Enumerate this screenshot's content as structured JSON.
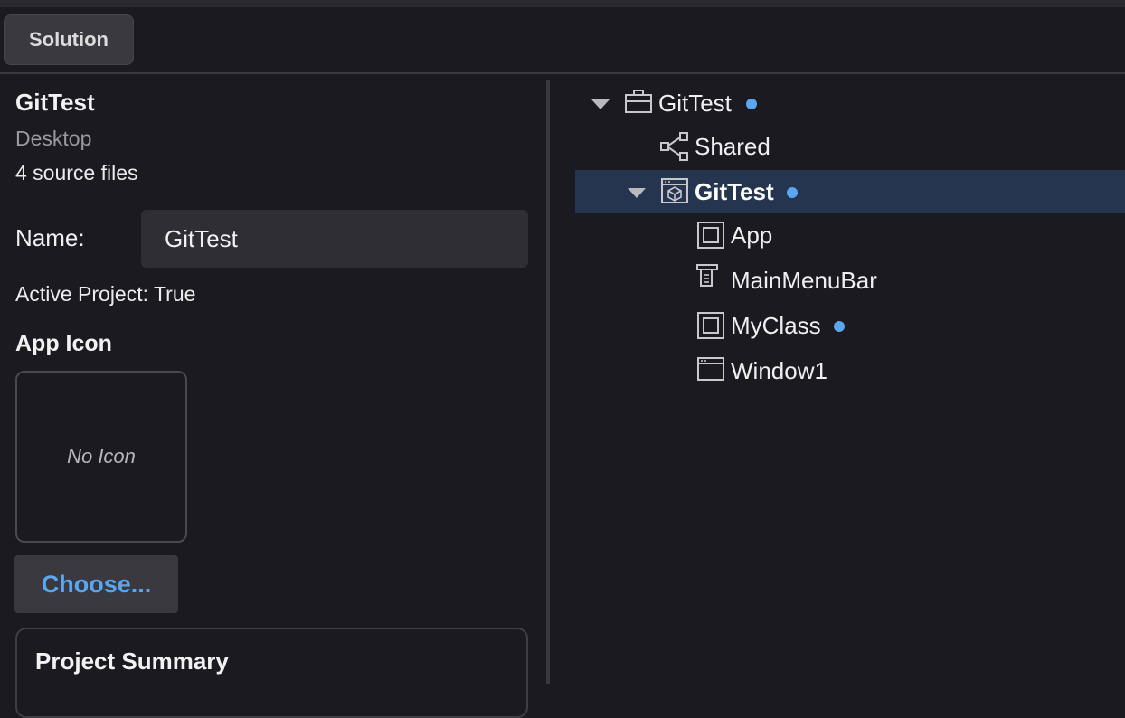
{
  "toolbar": {
    "solution_tab": "Solution"
  },
  "project": {
    "title": "GitTest",
    "platform": "Desktop",
    "source_files": "4 source files",
    "name_label": "Name:",
    "name_value": "GitTest",
    "active_project": "Active Project: True",
    "app_icon_label": "App Icon",
    "no_icon": "No Icon",
    "choose_label": "Choose...",
    "summary_title": "Project Summary"
  },
  "tree": {
    "root": {
      "label": "GitTest",
      "icon": "briefcase-icon",
      "modified": true
    },
    "shared": {
      "label": "Shared",
      "icon": "share-icon"
    },
    "project": {
      "label": "GitTest",
      "icon": "app-bundle-icon",
      "modified": true,
      "selected": true
    },
    "items": [
      {
        "label": "App",
        "icon": "class-icon",
        "modified": false
      },
      {
        "label": "MainMenuBar",
        "icon": "menubar-icon",
        "modified": false
      },
      {
        "label": "MyClass",
        "icon": "class-icon",
        "modified": true
      },
      {
        "label": "Window1",
        "icon": "window-icon",
        "modified": false
      }
    ]
  },
  "colors": {
    "accent": "#5aa6f0",
    "selection": "#25354f",
    "background": "#1b1a20"
  }
}
